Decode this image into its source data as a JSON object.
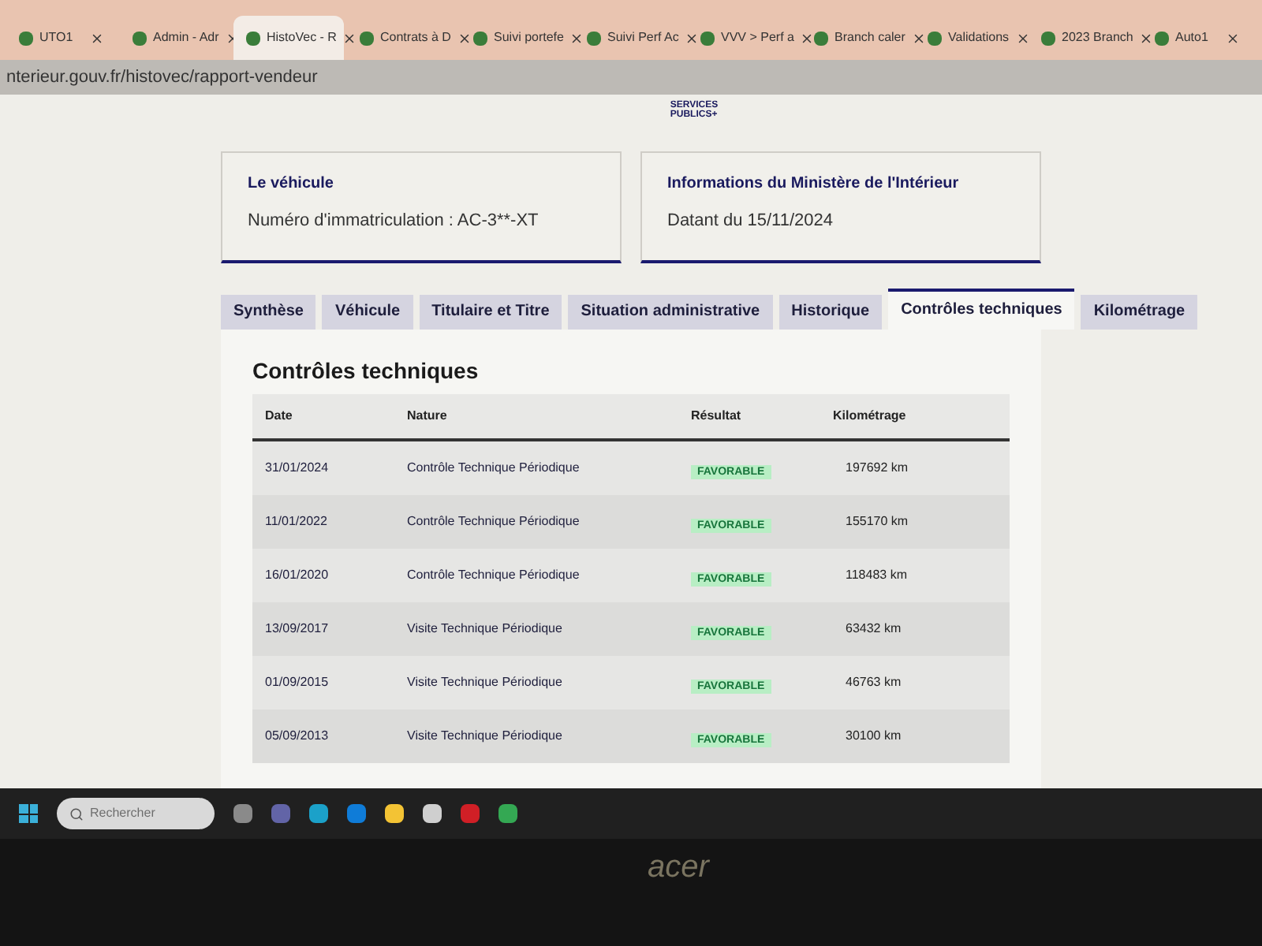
{
  "browser_tabs": [
    {
      "label": "UTO1",
      "selected": false
    },
    {
      "label": "Admin - Adr",
      "selected": false
    },
    {
      "label": "HistoVec - R",
      "selected": true
    },
    {
      "label": "Contrats à D",
      "selected": false
    },
    {
      "label": "Suivi portefe",
      "selected": false
    },
    {
      "label": "Suivi Perf Ac",
      "selected": false
    },
    {
      "label": "VVV > Perf a",
      "selected": false
    },
    {
      "label": "Branch caler",
      "selected": false
    },
    {
      "label": "Validations",
      "selected": false
    },
    {
      "label": "2023 Branch",
      "selected": false
    },
    {
      "label": "Auto1",
      "selected": false
    }
  ],
  "address_bar": {
    "url": "nterieur.gouv.fr/histovec/rapport-vendeur"
  },
  "header": {
    "logo_lines": [
      "SERVICES",
      "PUBLICS+"
    ]
  },
  "cards": [
    {
      "title": "Le véhicule",
      "text": "Numéro d'immatriculation : AC-3**-XT"
    },
    {
      "title": "Informations du Ministère de l'Intérieur",
      "text": "Datant du 15/11/2024"
    }
  ],
  "page_tabs": [
    {
      "label": "Synthèse",
      "selected": false
    },
    {
      "label": "Véhicule",
      "selected": false
    },
    {
      "label": "Titulaire et Titre",
      "selected": false
    },
    {
      "label": "Situation administrative",
      "selected": false
    },
    {
      "label": "Historique",
      "selected": false
    },
    {
      "label": "Contrôles techniques",
      "selected": true
    },
    {
      "label": "Kilométrage",
      "selected": false
    }
  ],
  "section": {
    "title": "Contrôles techniques",
    "columns": [
      "Date",
      "Nature",
      "Résultat",
      "Kilométrage"
    ],
    "rows": [
      {
        "date": "31/01/2024",
        "nature": "Contrôle Technique Périodique",
        "result": "FAVORABLE",
        "mileage": "197692 km"
      },
      {
        "date": "11/01/2022",
        "nature": "Contrôle Technique Périodique",
        "result": "FAVORABLE",
        "mileage": "155170 km"
      },
      {
        "date": "16/01/2020",
        "nature": "Contrôle Technique Périodique",
        "result": "FAVORABLE",
        "mileage": "118483 km"
      },
      {
        "date": "13/09/2017",
        "nature": "Visite Technique Périodique",
        "result": "FAVORABLE",
        "mileage": "63432 km"
      },
      {
        "date": "01/09/2015",
        "nature": "Visite Technique Périodique",
        "result": "FAVORABLE",
        "mileage": "46763 km"
      },
      {
        "date": "05/09/2013",
        "nature": "Visite Technique Périodique",
        "result": "FAVORABLE",
        "mileage": "30100 km"
      }
    ]
  },
  "taskbar": {
    "search_placeholder": "Rechercher"
  },
  "bezel": {
    "brand": "acer"
  }
}
